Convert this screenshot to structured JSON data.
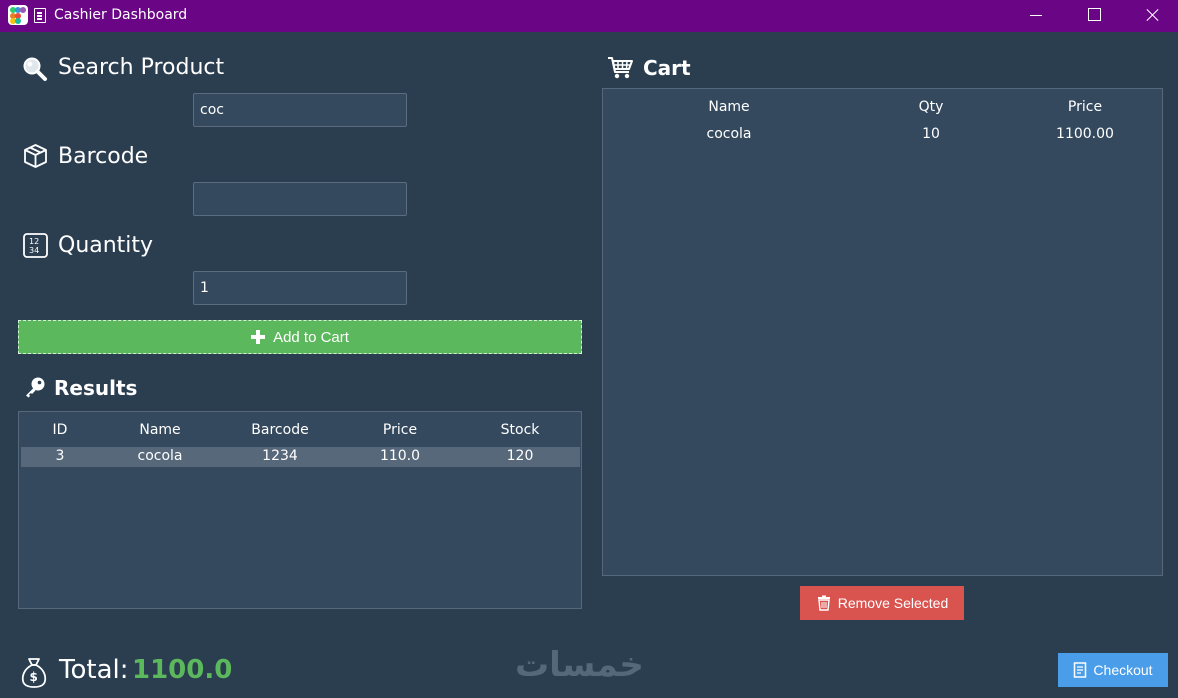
{
  "window": {
    "title": "Cashier Dashboard"
  },
  "search": {
    "heading": "Search Product",
    "value": "coc"
  },
  "barcode": {
    "heading": "Barcode",
    "value": ""
  },
  "quantity": {
    "heading": "Quantity",
    "value": "1"
  },
  "add_button": {
    "label": "Add to Cart"
  },
  "results": {
    "heading": "Results",
    "columns": [
      "ID",
      "Name",
      "Barcode",
      "Price",
      "Stock"
    ],
    "rows": [
      {
        "id": "3",
        "name": "cocola",
        "barcode": "1234",
        "price": "110.0",
        "stock": "120"
      }
    ]
  },
  "cart": {
    "heading": "Cart",
    "columns": [
      "Name",
      "Qty",
      "Price"
    ],
    "rows": [
      {
        "name": "cocola",
        "qty": "10",
        "price": "1100.00"
      }
    ]
  },
  "remove_button": {
    "label": "Remove Selected"
  },
  "total": {
    "label": "Total:",
    "value": "1100.0"
  },
  "checkout_button": {
    "label": "Checkout"
  },
  "watermark": {
    "text": "خمسات"
  },
  "colors": {
    "titlebar": "#6a0586",
    "background": "#2b3e50",
    "success": "#5cb85c",
    "danger": "#d9534f",
    "primary": "#4a9de8"
  }
}
